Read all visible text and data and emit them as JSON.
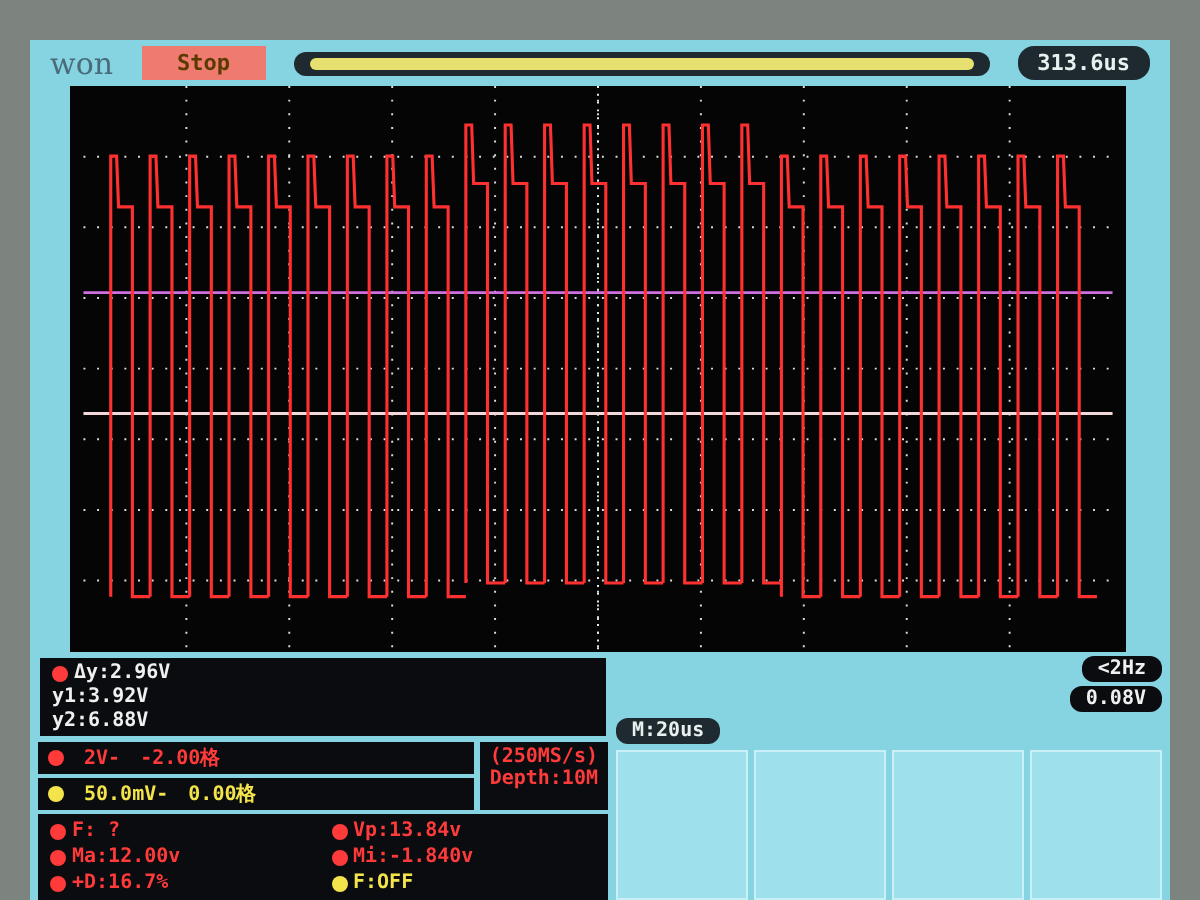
{
  "top_bar": {
    "logo": "won",
    "status": "Stop",
    "time_offset": "313.6us"
  },
  "cursor_readouts": [
    {
      "text": "Δy:2.96V",
      "marker": true
    },
    {
      "text": "y1:3.92V",
      "marker": false
    },
    {
      "text": "y2:6.88V",
      "marker": false
    }
  ],
  "channels": [
    {
      "scale": "2V-",
      "offset": "-2.00格",
      "color": "#ff3a3a"
    },
    {
      "scale": "50.0mV-",
      "offset": "0.00格",
      "color": "#f2e44a"
    }
  ],
  "sampling": {
    "rate": "(250MS/s)",
    "depth": "Depth:10M"
  },
  "timebase": "M:20us",
  "trigger": {
    "frequency": "<2Hz",
    "level": "0.08V"
  },
  "measurements": [
    {
      "text": "F: ?",
      "color": "#ff3a3a"
    },
    {
      "text": "Vp:13.84v",
      "color": "#ff3a3a"
    },
    {
      "text": "Ma:12.00v",
      "color": "#ff3a3a"
    },
    {
      "text": "Mi:-1.840v",
      "color": "#ff3a3a"
    },
    {
      "text": "+D:16.7%",
      "color": "#ff3a3a"
    },
    {
      "text": "F:OFF",
      "color": "#f2e44a"
    }
  ]
}
